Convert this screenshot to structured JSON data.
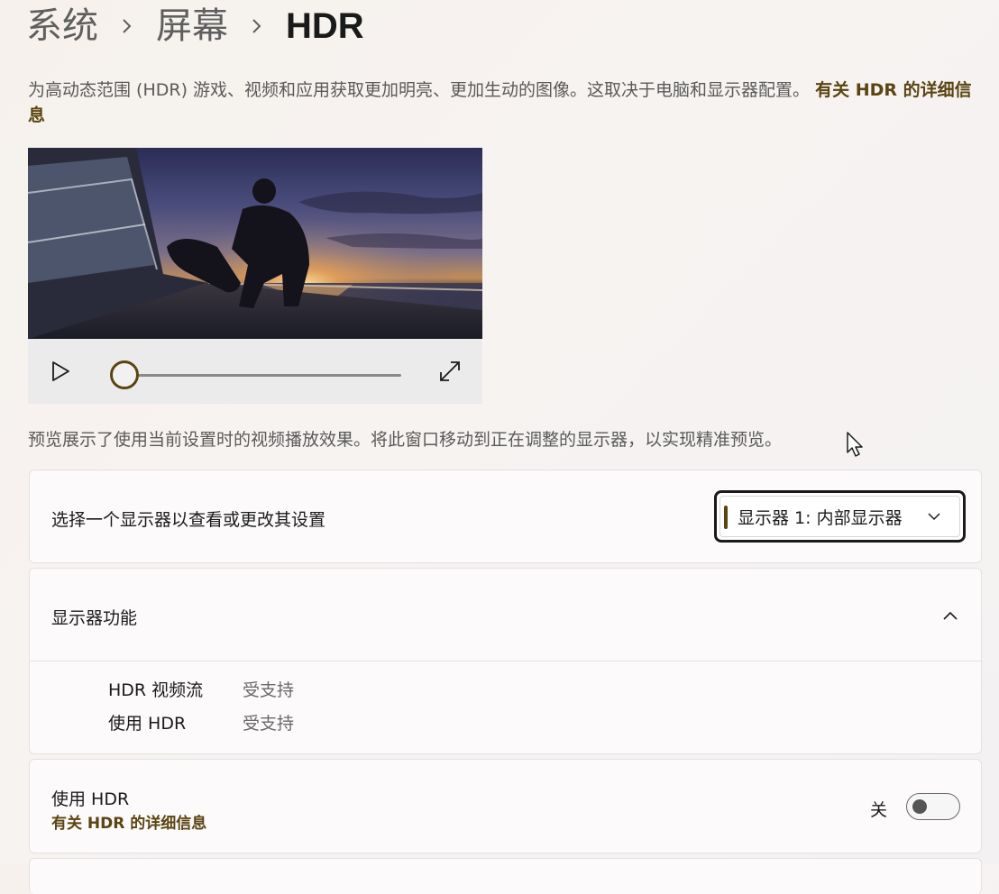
{
  "breadcrumb": {
    "level1": "系统",
    "level2": "屏幕",
    "current": "HDR"
  },
  "description": {
    "text": "为高动态范围 (HDR) 游戏、视频和应用获取更加明亮、更加生动的图像。这取决于电脑和显示器配置。",
    "link": "有关 HDR 的详细信息"
  },
  "video": {
    "progress": 0
  },
  "preview_note": "预览展示了使用当前设置时的视频播放效果。将此窗口移动到正在调整的显示器，以实现精准预览。",
  "display_select": {
    "label": "选择一个显示器以查看或更改其设置",
    "value": "显示器 1: 内部显示器"
  },
  "display_features": {
    "title": "显示器功能",
    "expanded": true,
    "items": [
      {
        "name": "HDR 视频流",
        "status": "受支持"
      },
      {
        "name": "使用 HDR",
        "status": "受支持"
      }
    ]
  },
  "use_hdr": {
    "label": "使用 HDR",
    "link": "有关 HDR 的详细信息",
    "state_label": "关",
    "enabled": false
  },
  "colors": {
    "accent": "#5a4411",
    "text": "#1b1b1b",
    "secondary_text": "#5a5a5a"
  },
  "icons": {
    "play": "play-icon",
    "fullscreen": "fullscreen-icon",
    "dropdown": "chevron-down-icon",
    "collapse": "chevron-up-icon"
  }
}
